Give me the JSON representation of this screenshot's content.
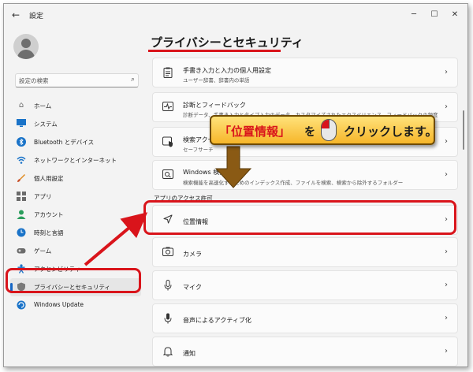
{
  "window": {
    "title": "設定"
  },
  "sidebar": {
    "search_placeholder": "設定の検索",
    "items": [
      {
        "label": "ホーム",
        "icon": "home-icon"
      },
      {
        "label": "システム",
        "icon": "monitor-icon"
      },
      {
        "label": "Bluetooth とデバイス",
        "icon": "bluetooth-icon"
      },
      {
        "label": "ネットワークとインターネット",
        "icon": "wifi-icon"
      },
      {
        "label": "個人用設定",
        "icon": "brush-icon"
      },
      {
        "label": "アプリ",
        "icon": "apps-icon"
      },
      {
        "label": "アカウント",
        "icon": "person-icon"
      },
      {
        "label": "時刻と言語",
        "icon": "globe-clock-icon"
      },
      {
        "label": "ゲーム",
        "icon": "gamepad-icon"
      },
      {
        "label": "アクセシビリティ",
        "icon": "accessibility-icon"
      },
      {
        "label": "プライバシーとセキュリティ",
        "icon": "shield-icon"
      },
      {
        "label": "Windows Update",
        "icon": "update-icon"
      }
    ]
  },
  "main": {
    "title": "プライバシーとセキュリティ",
    "cards_top": [
      {
        "title": "手書き入力と入力の個人用設定",
        "subtitle": "ユーザー辞書、辞書内の単語",
        "icon": "clipboard-list-icon"
      },
      {
        "title": "診断とフィードバック",
        "subtitle": "診断データ、手書き入力とタイプ入力のデータ、カスタマイズされたエクスペリエンス、フィードバックの頻度",
        "icon": "activity-icon"
      },
      {
        "title": "検索アクセス許可",
        "subtitle": "セーフサーチ",
        "icon": "search-shield-icon"
      },
      {
        "title": "Windows 検索",
        "subtitle": "検索機能を高速化するためのインデックス作成、ファイルを検索、検索から除外するフォルダー",
        "icon": "search-window-icon"
      }
    ],
    "section_label": "アプリのアクセス許可",
    "cards_perm": [
      {
        "title": "位置情報",
        "icon": "location-arrow-icon"
      },
      {
        "title": "カメラ",
        "icon": "camera-icon"
      },
      {
        "title": "マイク",
        "icon": "mic-icon"
      },
      {
        "title": "音声によるアクティブ化",
        "icon": "mic-voice-icon"
      },
      {
        "title": "通知",
        "icon": "bell-icon"
      }
    ]
  },
  "callout": {
    "part1": "「位置情報」",
    "part2": "を",
    "part3": "クリックします。"
  },
  "colors": {
    "accent": "#1666c5",
    "annotation_red": "#d9141b",
    "callout_yellow": "#f6b62a"
  }
}
